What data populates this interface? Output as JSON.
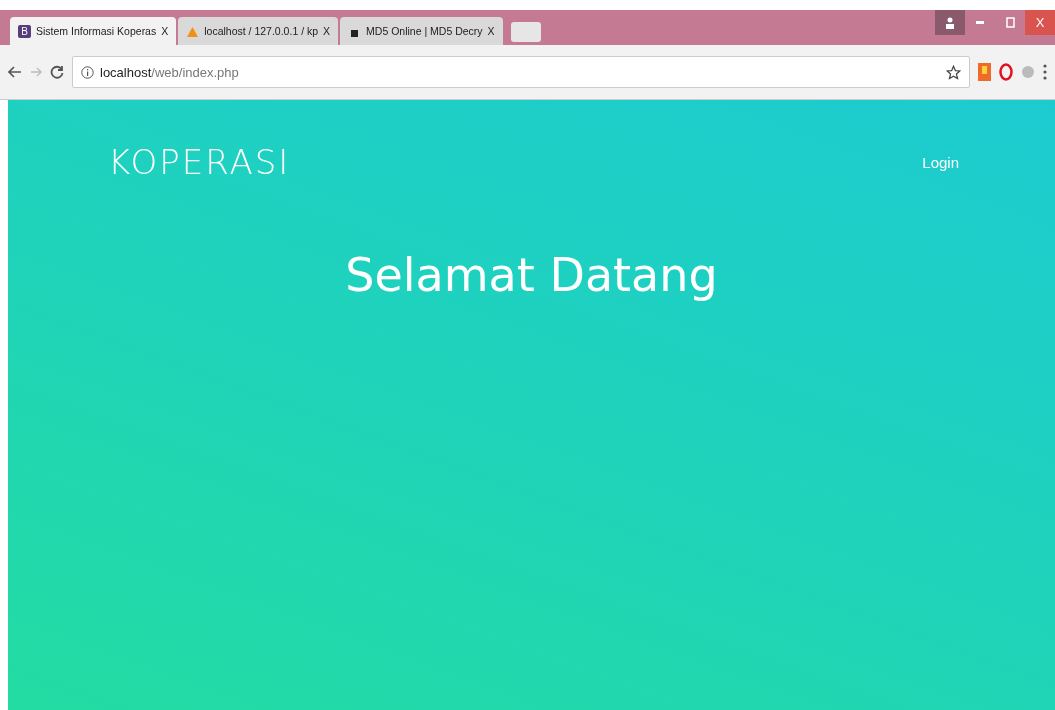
{
  "browser": {
    "tabs": [
      {
        "favicon": "B",
        "title": "Sistem Informasi Koperas",
        "close": "X",
        "selected": true
      },
      {
        "title": "localhost / 127.0.0.1 / kp",
        "close": "X",
        "selected": false
      },
      {
        "title": "MD5 Online | MD5 Decry",
        "close": "X",
        "selected": false
      }
    ],
    "window_close": "X",
    "address": {
      "host": "localhost",
      "path": "/web/index.php"
    }
  },
  "page": {
    "brand": "KOPERASI",
    "nav": [
      "Login"
    ],
    "heading": "Selamat Datang"
  }
}
